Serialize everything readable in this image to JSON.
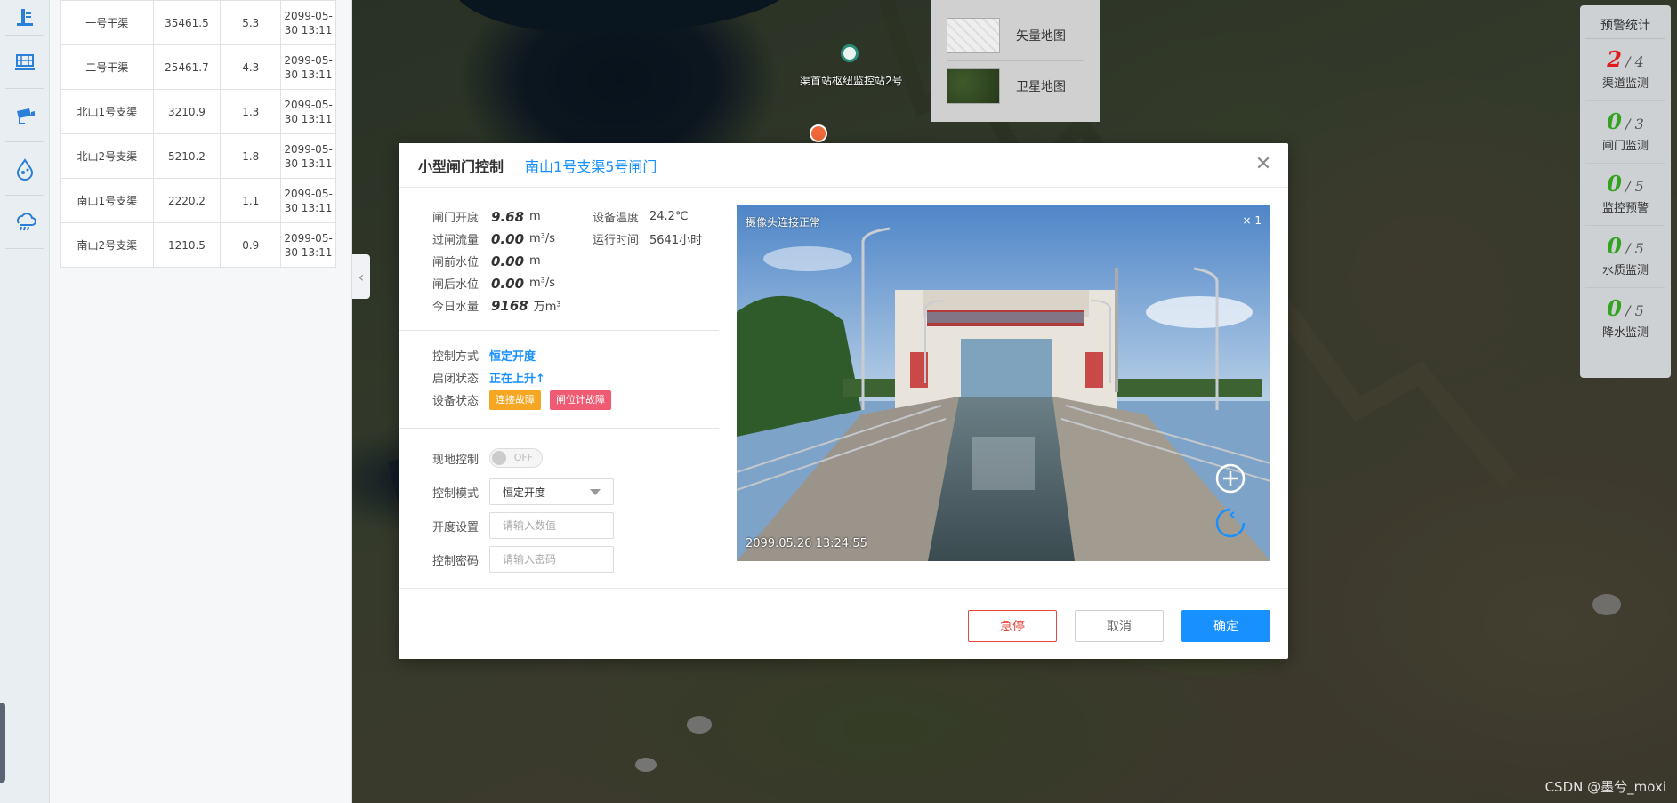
{
  "map": {
    "station_label": "渠首站枢纽监控站2号"
  },
  "map_switch": {
    "items": [
      {
        "label": "矢量地图"
      },
      {
        "label": "卫星地图"
      }
    ]
  },
  "table": {
    "rows": [
      {
        "name": "一号干渠",
        "flow": "35461.5",
        "level": "5.3",
        "time_a": "2099-05-",
        "time_b": "30 13:11"
      },
      {
        "name": "二号干渠",
        "flow": "25461.7",
        "level": "4.3",
        "time_a": "2099-05-",
        "time_b": "30 13:11"
      },
      {
        "name": "北山1号支渠",
        "flow": "3210.9",
        "level": "1.3",
        "time_a": "2099-05-",
        "time_b": "30 13:11"
      },
      {
        "name": "北山2号支渠",
        "flow": "5210.2",
        "level": "1.8",
        "time_a": "2099-05-",
        "time_b": "30 13:11"
      },
      {
        "name": "南山1号支渠",
        "flow": "2220.2",
        "level": "1.1",
        "time_a": "2099-05-",
        "time_b": "30 13:11"
      },
      {
        "name": "南山2号支渠",
        "flow": "1210.5",
        "level": "0.9",
        "time_a": "2099-05-",
        "time_b": "30 13:11"
      }
    ]
  },
  "warnings": {
    "title": "预警统计",
    "items": [
      {
        "count": "2",
        "total": "/ 4",
        "label": "渠道监测",
        "color": "#e11a1a"
      },
      {
        "count": "0",
        "total": "/ 3",
        "label": "闸门监测",
        "color": "#33a31f"
      },
      {
        "count": "0",
        "total": "/ 5",
        "label": "监控预警",
        "color": "#33a31f"
      },
      {
        "count": "0",
        "total": "/ 5",
        "label": "水质监测",
        "color": "#33a31f"
      },
      {
        "count": "0",
        "total": "/ 5",
        "label": "降水监测",
        "color": "#33a31f"
      }
    ]
  },
  "dialog": {
    "title": "小型闸门控制",
    "subtitle": "南山1号支渠5号闸门",
    "close_icon": "close-icon",
    "stats": {
      "gate_opening": {
        "label": "闸门开度",
        "value": "9.68",
        "unit": "m"
      },
      "pass_flow": {
        "label": "过闸流量",
        "value": "0.00",
        "unit": "m³/s"
      },
      "front_level": {
        "label": "闸前水位",
        "value": "0.00",
        "unit": "m"
      },
      "back_level": {
        "label": "闸后水位",
        "value": "0.00",
        "unit": "m³/s"
      },
      "today_volume": {
        "label": "今日水量",
        "value": "9168",
        "unit": "万m³"
      },
      "device_temp": {
        "label": "设备温度",
        "value": "24.2℃"
      },
      "run_time": {
        "label": "运行时间",
        "value": "5641小时"
      }
    },
    "status": {
      "control_mode_label": "控制方式",
      "control_mode_value": "恒定开度",
      "switch_state_label": "启闭状态",
      "switch_state_value": "正在上升↑",
      "device_state_label": "设备状态",
      "badges": [
        "连接故障",
        "闸位计故障"
      ]
    },
    "controls": {
      "local_label": "现地控制",
      "local_toggle_text": "OFF",
      "mode_label": "控制模式",
      "mode_value": "恒定开度",
      "opening_label": "开度设置",
      "opening_placeholder": "请输入数值",
      "password_label": "控制密码",
      "password_placeholder": "请输入密码"
    },
    "video": {
      "status": "摄像头连接正常",
      "zoom": "× 1",
      "timestamp": "2099.05.26 13:24:55"
    },
    "footer": {
      "stop_label": "急停",
      "cancel_label": "取消",
      "ok_label": "确定"
    }
  },
  "watermark": "CSDN @墨兮_moxi"
}
